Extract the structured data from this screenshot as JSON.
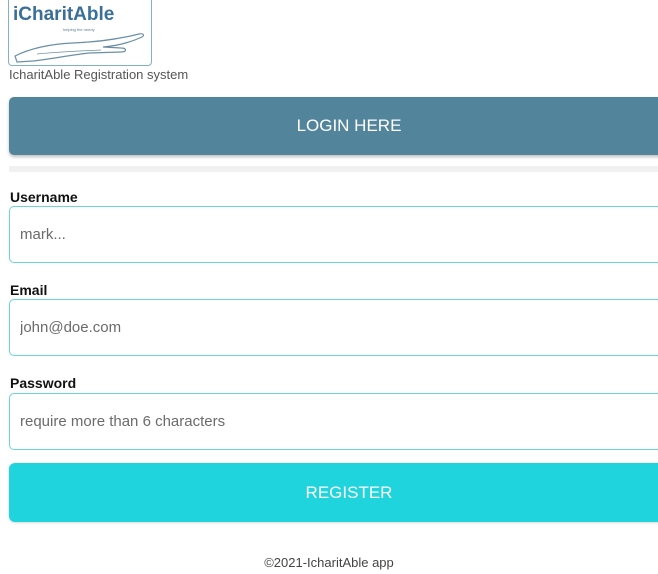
{
  "logo": {
    "wordmark": "iCharitAble",
    "tagline": "helping the needy"
  },
  "header": {
    "subtitle": "IcharitAble Registration system"
  },
  "login_banner": {
    "label": "LOGIN HERE"
  },
  "form": {
    "username": {
      "label": "Username",
      "placeholder": "mark...",
      "value": ""
    },
    "email": {
      "label": "Email",
      "placeholder": "john@doe.com",
      "value": ""
    },
    "password": {
      "label": "Password",
      "placeholder": "require more than 6 characters",
      "value": ""
    },
    "submit_label": "REGISTER"
  },
  "footer": {
    "text": "©2021-IcharitAble app"
  },
  "colors": {
    "login_banner": "#52859b",
    "register_button": "#1fd4dc",
    "field_border": "#6ad4dc"
  }
}
